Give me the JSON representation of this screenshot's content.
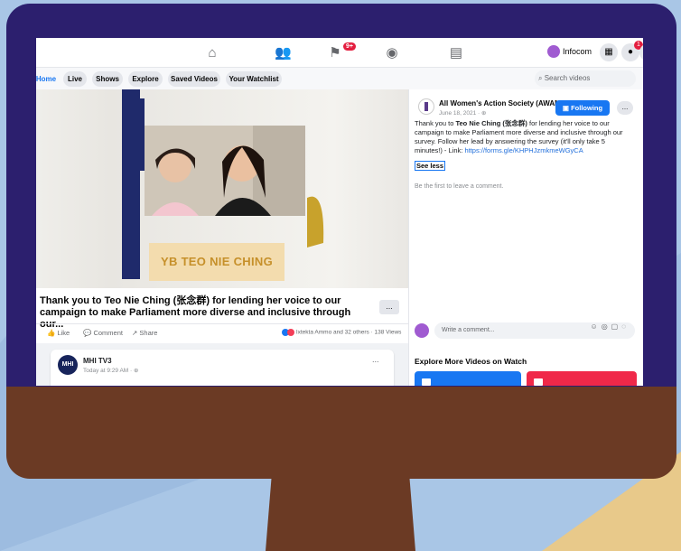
{
  "topbar": {
    "user_name": "Infocom",
    "flag_badge": "9+",
    "notif_badge_1": "1",
    "notif_badge_2": "1"
  },
  "tabs": [
    "Home",
    "Live",
    "Shows",
    "Explore",
    "Saved Videos",
    "Your Watchlist"
  ],
  "search": {
    "placeholder": "Search videos"
  },
  "video": {
    "name_card": "YB TEO NIE CHING",
    "title": "Thank you to Teo Nie Ching (张念群) for lending her voice to our campaign to make Parliament more diverse and inclusive through our...",
    "more_label": "...",
    "actions": {
      "like": "Like",
      "comment": "Comment",
      "share": "Share"
    },
    "reactions_text": "Ixtekta Ammo and 32 others · 138 Views"
  },
  "side": {
    "page_name": "All Women's Action Society (AWAM)",
    "post_date": "June 18, 2021 · ⊕",
    "following_label": "Following",
    "more_label": "...",
    "caption_pre": "Thank you to ",
    "caption_bold": "Teo Nie Ching (张念群)",
    "caption_post": " for lending her voice to our campaign to make Parliament more diverse and inclusive through our survey. Follow her lead by answering the survey (it'll only take 5 minutes!) - Link: ",
    "caption_link": "https://forms.gle/KHPHJzmkmeWGyCA",
    "see_less": "See less",
    "first_comment": "Be the first to leave a comment.",
    "write_comment": "Write a comment...",
    "explore_title": "Explore More Videos on Watch"
  },
  "feed": {
    "channel_logo": "MHI",
    "channel_name": "MHI TV3",
    "channel_time": "Today at 9:29 AM · ⊕",
    "more_label": "..."
  },
  "colors": {
    "bezel": "#2c1f6e",
    "base": "#6b3a24",
    "background": "#a9c6e6",
    "accent": "#1877f2",
    "explore_red": "#f02849"
  }
}
